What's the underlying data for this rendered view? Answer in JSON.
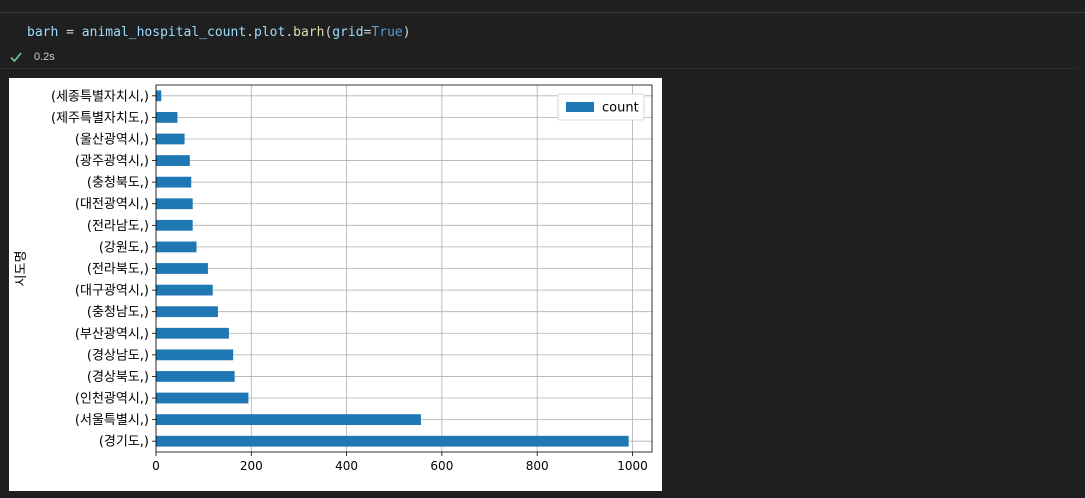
{
  "cell": {
    "code": {
      "var": "barh",
      "op": " = ",
      "obj": "animal_hospital_count",
      "dot1": ".",
      "attr": "plot",
      "dot2": ".",
      "fn": "barh",
      "open": "(",
      "kwarg": "grid",
      "eq": "=",
      "kwval": "True",
      "close": ")"
    },
    "status": {
      "time": "0.2s",
      "icon": "check-icon",
      "color": "#73c991"
    }
  },
  "chart_data": {
    "type": "bar",
    "orientation": "horizontal",
    "categories": [
      "(경기도,)",
      "(서울특별시,)",
      "(인천광역시,)",
      "(경상북도,)",
      "(경상남도,)",
      "(부산광역시,)",
      "(충청남도,)",
      "(대구광역시,)",
      "(전라북도,)",
      "(강원도,)",
      "(전라남도,)",
      "(대전광역시,)",
      "(충청북도,)",
      "(광주광역시,)",
      "(울산광역시,)",
      "(제주특별자치도,)",
      "(세종특별자치시,)"
    ],
    "series": [
      {
        "name": "count",
        "color": "#1f77b4",
        "values": [
          992,
          556,
          194,
          165,
          162,
          153,
          130,
          119,
          109,
          85,
          77,
          77,
          74,
          71,
          60,
          45,
          11
        ]
      }
    ],
    "xticks": [
      0,
      200,
      400,
      600,
      800,
      1000
    ],
    "xlim": [
      0,
      1041
    ],
    "ylabel": "시도명",
    "xlabel": "",
    "grid": true,
    "legend": "top-right"
  }
}
